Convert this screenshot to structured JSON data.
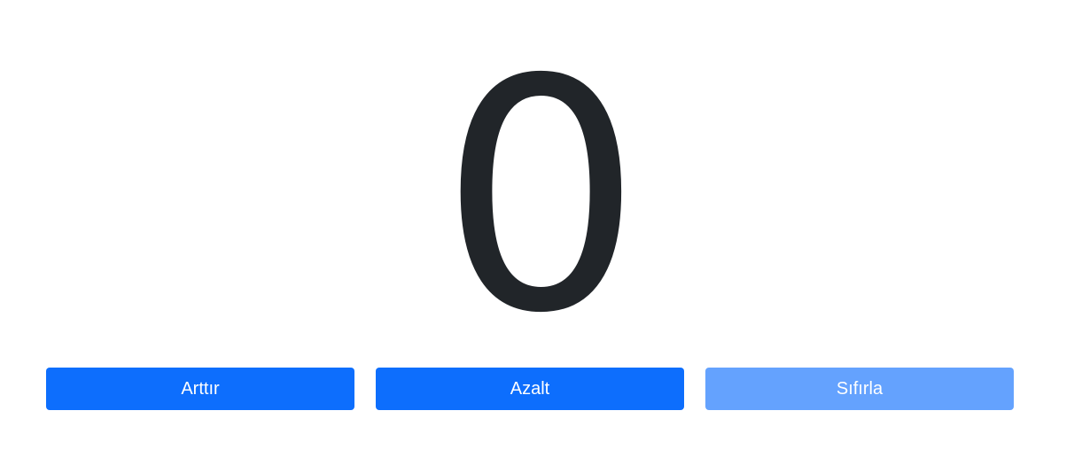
{
  "counter": {
    "value": "0"
  },
  "buttons": {
    "increment_label": "Arttır",
    "decrement_label": "Azalt",
    "reset_label": "Sıfırla"
  },
  "colors": {
    "primary": "#0d6efd",
    "reset_disabled": "#64a2fe",
    "counter_text": "#212529"
  }
}
